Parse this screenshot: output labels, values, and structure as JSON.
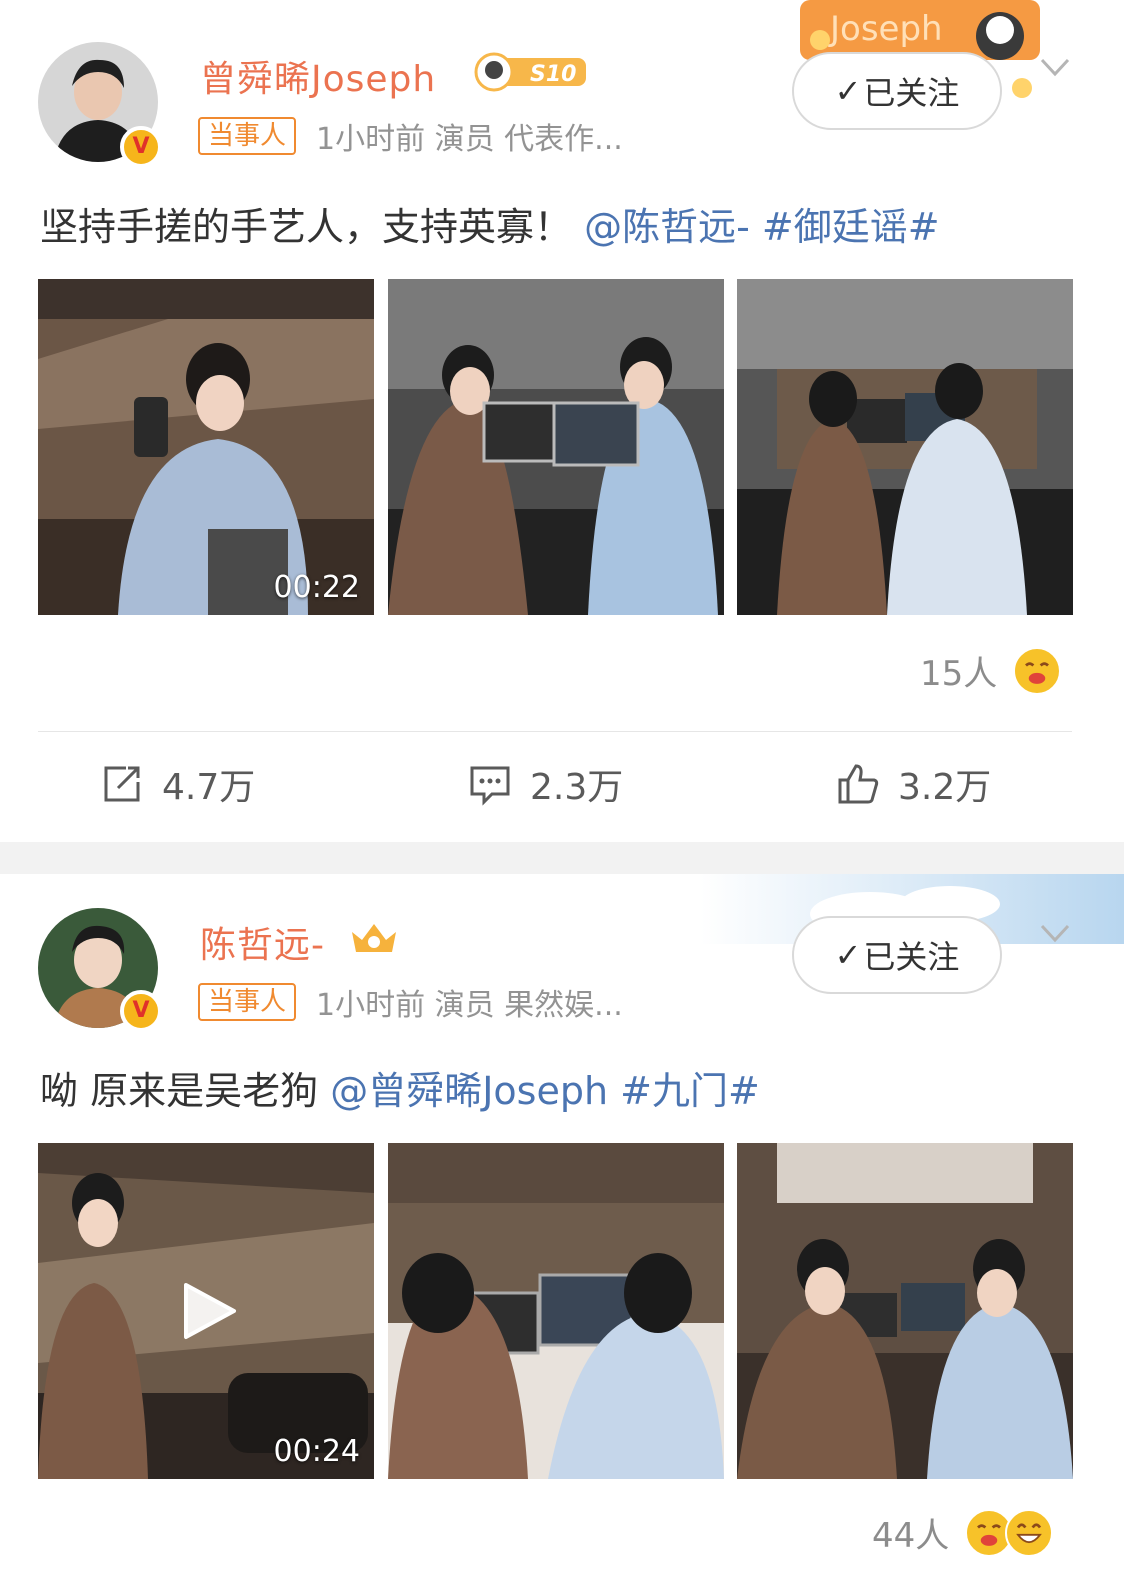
{
  "posts": [
    {
      "username": "曾舜晞Joseph",
      "vip_badge": "S10",
      "card_decoration": "Joseph",
      "party_tag": "当事人",
      "meta": "1小时前   演员 代表作...",
      "follow_label": "已关注",
      "text_plain": "坚持手搓的手艺人，支持英寡！",
      "mention": "@陈哲远-",
      "topic": "#御廷谣#",
      "video_duration": "00:22",
      "reaction_count": "15人",
      "actions": {
        "repost": "4.7万",
        "comment": "2.3万",
        "like": "3.2万"
      }
    },
    {
      "username": "陈哲远-",
      "party_tag": "当事人",
      "meta": "1小时前   演员 果然娱...",
      "follow_label": "已关注",
      "text_plain": "呦 原来是吴老狗",
      "mention": "@曾舜晞Joseph",
      "topic": "#九门#",
      "video_duration": "00:24",
      "reaction_count": "44人"
    }
  ],
  "colors": {
    "username": "#eb7350",
    "link": "#4b74b1",
    "party_tag": "#f08a30",
    "meta": "#939393",
    "separator": "#f2f2f2"
  },
  "icons": [
    "verified-v-icon",
    "checkmark-icon",
    "chevron-down-icon",
    "repost-icon",
    "comment-icon",
    "like-icon",
    "play-icon",
    "emoji-reaction-icon"
  ]
}
